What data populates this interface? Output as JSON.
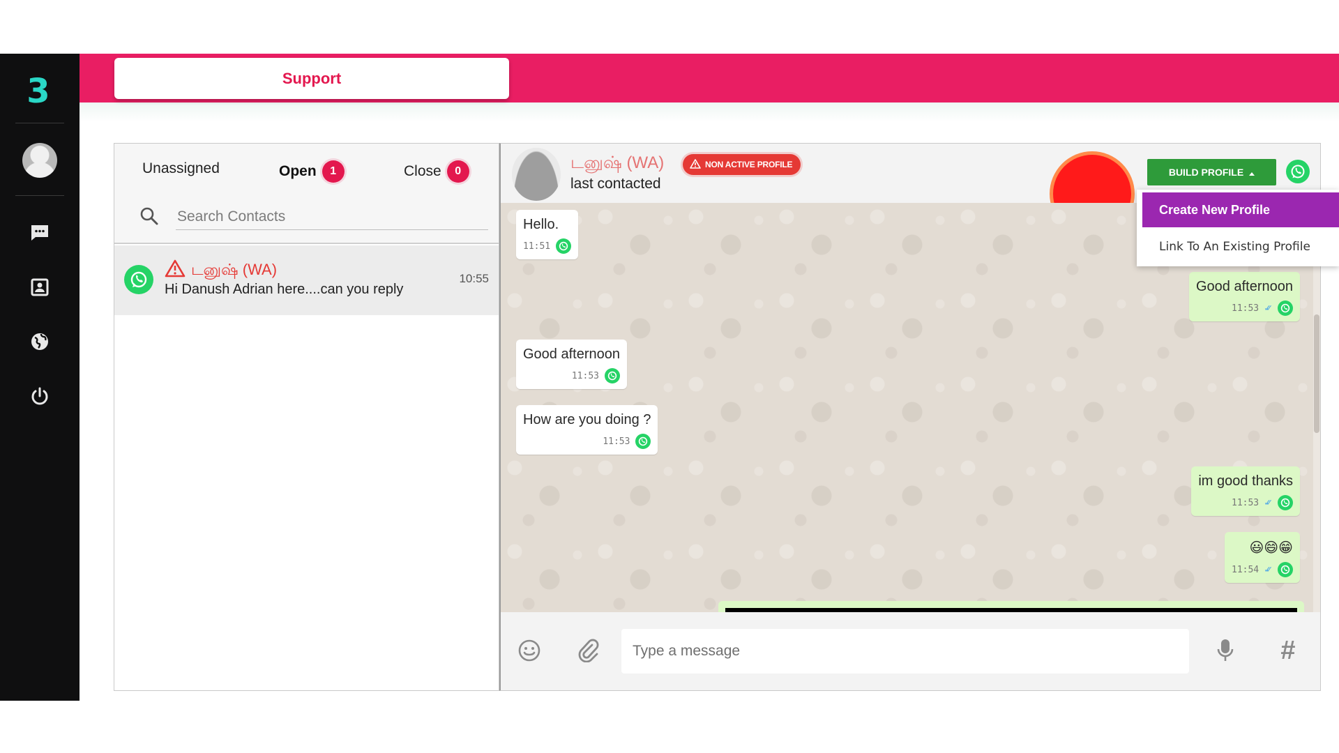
{
  "app": {
    "logo_text": "3",
    "page_tab": "Support"
  },
  "nav": {
    "icons": [
      "avatar",
      "chat-icon",
      "contacts-icon",
      "globe-icon",
      "power-icon"
    ]
  },
  "contacts": {
    "tabs": [
      {
        "label": "Unassigned",
        "count": null
      },
      {
        "label": "Open",
        "count": "1"
      },
      {
        "label": "Close",
        "count": "0"
      }
    ],
    "search_placeholder": "Search Contacts",
    "items": [
      {
        "name": "டனுஷ் (WA)",
        "preview": "Hi Danush Adrian here....can you reply",
        "time": "10:55"
      }
    ]
  },
  "chat": {
    "contact_name": "டனுஷ் (WA)",
    "subtitle": "last contacted",
    "profile_badge": "NON ACTIVE PROFILE",
    "build_profile_label": "BUILD PROFILE",
    "dropdown": {
      "create_label": "Create New Profile",
      "link_label": "Link To An Existing Profile"
    },
    "messages": [
      {
        "direction": "in",
        "text": "Hello.",
        "time": "11:51"
      },
      {
        "direction": "out",
        "text": "Good afternoon",
        "time": "11:53"
      },
      {
        "direction": "in",
        "text": "Good afternoon",
        "time": "11:53"
      },
      {
        "direction": "in",
        "text": "How are you doing ?",
        "time": "11:53"
      },
      {
        "direction": "out",
        "text": "im good thanks",
        "time": "11:53"
      },
      {
        "direction": "out",
        "text": "😃😄😁",
        "time": "11:54"
      }
    ],
    "composer_placeholder": "Type a message",
    "composer_symbol": "#"
  },
  "colors": {
    "brand": "#e91e63",
    "support_text": "#e3174e",
    "whatsapp": "#25d366",
    "build_button": "#2e9b3a",
    "dropdown_active": "#9b27b0",
    "warning": "#e53935"
  }
}
